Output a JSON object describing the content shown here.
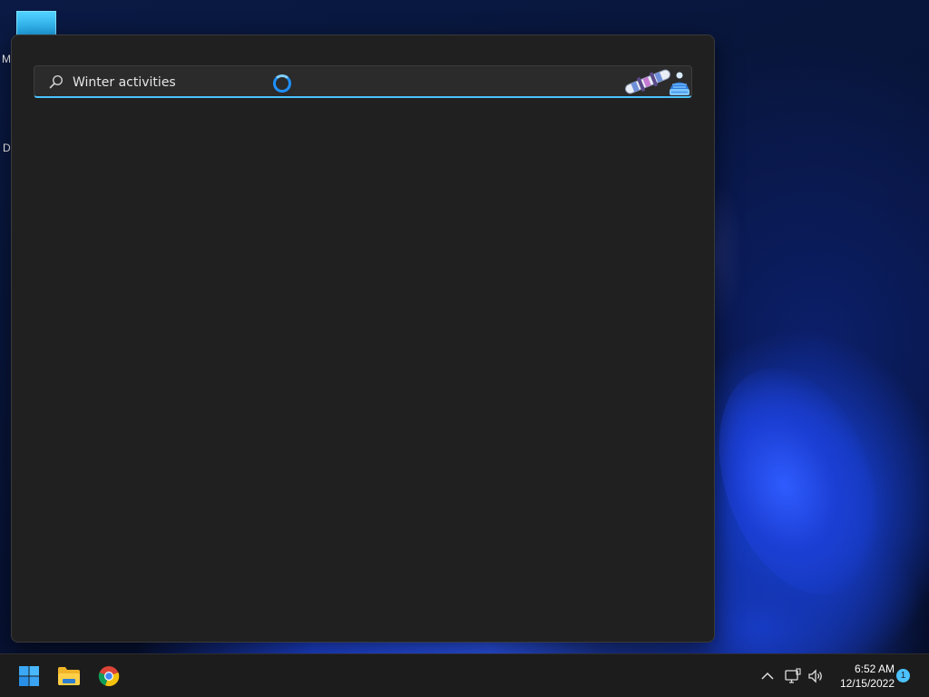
{
  "desktop": {
    "icons": [
      {
        "label_fragment": "M"
      },
      {
        "label_fragment": "Da"
      }
    ]
  },
  "search": {
    "value": "Winter activities",
    "placeholder": ""
  },
  "icons": {
    "search": "search-icon",
    "loading": "loading-icon",
    "highlight_snowboard": "snowboard-icon",
    "highlight_beanie": "beanie-icon",
    "start": "windows-logo-icon",
    "explorer": "folder-icon",
    "chrome": "chrome-icon",
    "tray_overflow": "chevron-up-icon",
    "network": "network-icon",
    "volume": "volume-icon"
  },
  "colors": {
    "accent": "#4cc2ff",
    "panel_bg": "#202020",
    "taskbar_bg": "#1c1c1c"
  },
  "taskbar": {
    "time": "6:52 AM",
    "date": "12/15/2022",
    "notification_count": "1"
  }
}
